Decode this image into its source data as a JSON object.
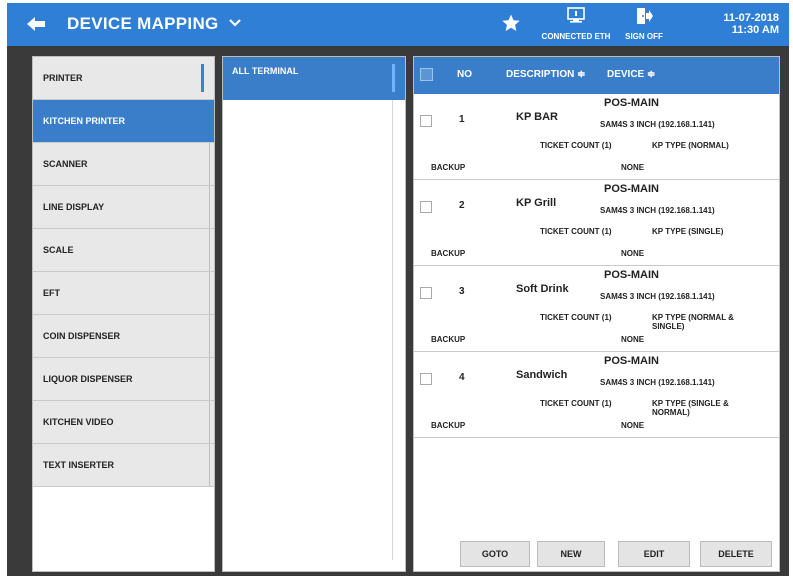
{
  "header": {
    "title": "DEVICE MAPPING",
    "connected_label": "CONNECTED ETH",
    "signoff_label": "SIGN OFF",
    "date": "11-07-2018",
    "time": "11:30 AM"
  },
  "devices": [
    {
      "label": "PRINTER"
    },
    {
      "label": "KITCHEN PRINTER"
    },
    {
      "label": "SCANNER"
    },
    {
      "label": "LINE DISPLAY"
    },
    {
      "label": "SCALE"
    },
    {
      "label": "EFT"
    },
    {
      "label": "COIN DISPENSER"
    },
    {
      "label": "LIQUOR DISPENSER"
    },
    {
      "label": "KITCHEN VIDEO"
    },
    {
      "label": "TEXT INSERTER"
    }
  ],
  "terminals": [
    {
      "label": "ALL TERMINAL"
    }
  ],
  "table": {
    "col_no": "NO",
    "col_description": "DESCRIPTION ≑",
    "col_device": "DEVICE ≑",
    "rows": [
      {
        "no": "1",
        "description": "KP BAR",
        "terminal": "POS-MAIN",
        "model": "SAM4S 3 INCH (192.168.1.141)",
        "ticket_count": "TICKET COUNT (1)",
        "kp_type": "KP TYPE (NORMAL)",
        "backup_label": "BACKUP",
        "backup_value": "NONE"
      },
      {
        "no": "2",
        "description": "KP Grill",
        "terminal": "POS-MAIN",
        "model": "SAM4S 3 INCH (192.168.1.141)",
        "ticket_count": "TICKET COUNT (1)",
        "kp_type": "KP TYPE (SINGLE)",
        "backup_label": "BACKUP",
        "backup_value": "NONE"
      },
      {
        "no": "3",
        "description": "Soft Drink",
        "terminal": "POS-MAIN",
        "model": "SAM4S 3 INCH (192.168.1.141)",
        "ticket_count": "TICKET COUNT (1)",
        "kp_type": "KP TYPE (NORMAL & SINGLE)",
        "backup_label": "BACKUP",
        "backup_value": "NONE"
      },
      {
        "no": "4",
        "description": "Sandwich",
        "terminal": "POS-MAIN",
        "model": "SAM4S 3 INCH (192.168.1.141)",
        "ticket_count": "TICKET COUNT (1)",
        "kp_type": "KP TYPE (SINGLE & NORMAL)",
        "backup_label": "BACKUP",
        "backup_value": "NONE"
      }
    ]
  },
  "buttons": {
    "goto": "GOTO",
    "new": "NEW",
    "edit": "EDIT",
    "delete": "DELETE"
  },
  "colors": {
    "header_blue": "#2f7fd6",
    "selected_blue": "#3a7dc9",
    "item_gray": "#e8e8e8"
  }
}
